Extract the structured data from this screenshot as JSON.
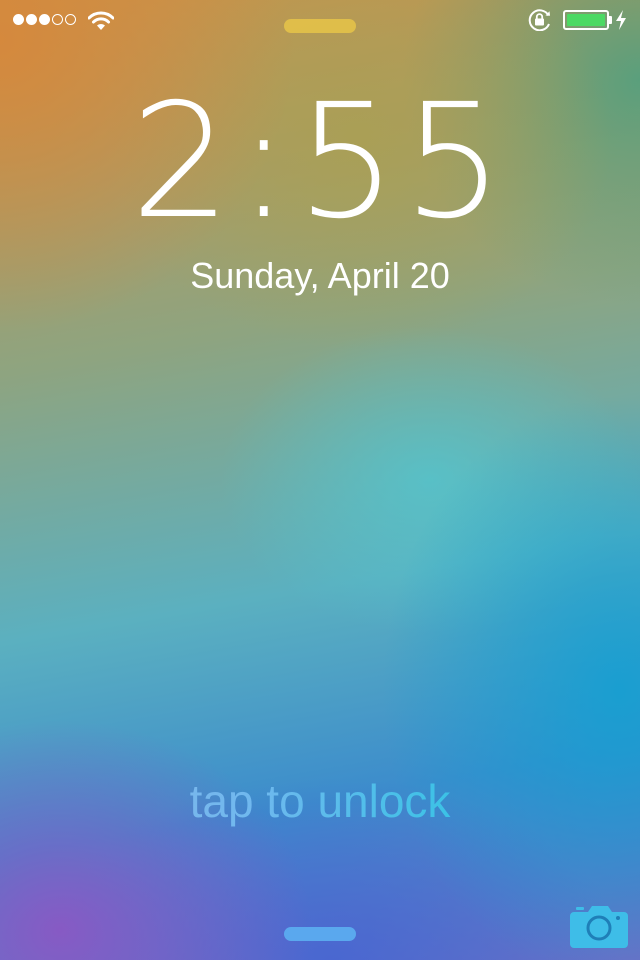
{
  "status_bar": {
    "signal_strength": 3,
    "signal_max": 5,
    "battery_level": 1.0,
    "battery_charging": true,
    "icons": [
      "signal-dots-icon",
      "wifi-icon",
      "rotation-lock-icon",
      "battery-icon",
      "charging-bolt-icon"
    ]
  },
  "lock_screen": {
    "time": "2:55",
    "date": "Sunday, April 20",
    "unlock_hint": "tap to unlock"
  },
  "colors": {
    "battery_fill": "#4cd964",
    "top_grabber": "#e2c04a",
    "bottom_grabber": "#5aa8ee",
    "camera_icon": "#3ebde8"
  }
}
